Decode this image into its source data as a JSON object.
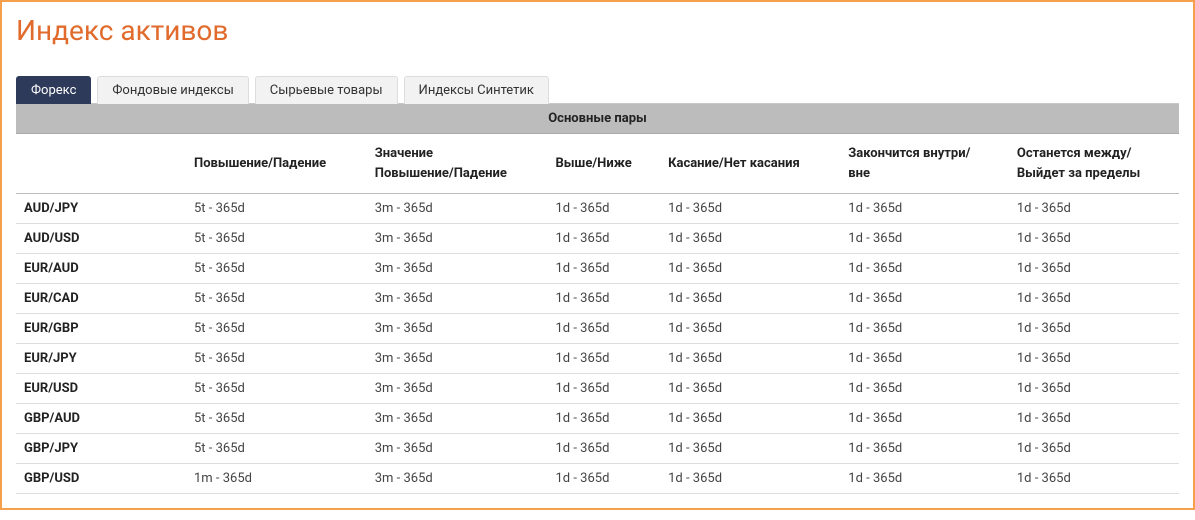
{
  "title": "Индекс активов",
  "tabs": [
    {
      "label": "Форекс",
      "active": true
    },
    {
      "label": "Фондовые индексы",
      "active": false
    },
    {
      "label": "Сырьевые товары",
      "active": false
    },
    {
      "label": "Индексы Синтетик",
      "active": false
    }
  ],
  "section_header": "Основные пары",
  "columns": [
    "",
    "Повышение/Падение",
    "Значение\nПовышение/Падение",
    "Выше/Ниже",
    "Касание/Нет касания",
    "Закончится внутри/\nвне",
    "Останется между/\nВыйдет за пределы"
  ],
  "rows": [
    {
      "pair": "AUD/JPY",
      "cells": [
        "5t - 365d",
        "3m - 365d",
        "1d - 365d",
        "1d - 365d",
        "1d - 365d",
        "1d - 365d"
      ]
    },
    {
      "pair": "AUD/USD",
      "cells": [
        "5t - 365d",
        "3m - 365d",
        "1d - 365d",
        "1d - 365d",
        "1d - 365d",
        "1d - 365d"
      ]
    },
    {
      "pair": "EUR/AUD",
      "cells": [
        "5t - 365d",
        "3m - 365d",
        "1d - 365d",
        "1d - 365d",
        "1d - 365d",
        "1d - 365d"
      ]
    },
    {
      "pair": "EUR/CAD",
      "cells": [
        "5t - 365d",
        "3m - 365d",
        "1d - 365d",
        "1d - 365d",
        "1d - 365d",
        "1d - 365d"
      ]
    },
    {
      "pair": "EUR/GBP",
      "cells": [
        "5t - 365d",
        "3m - 365d",
        "1d - 365d",
        "1d - 365d",
        "1d - 365d",
        "1d - 365d"
      ]
    },
    {
      "pair": "EUR/JPY",
      "cells": [
        "5t - 365d",
        "3m - 365d",
        "1d - 365d",
        "1d - 365d",
        "1d - 365d",
        "1d - 365d"
      ]
    },
    {
      "pair": "EUR/USD",
      "cells": [
        "5t - 365d",
        "3m - 365d",
        "1d - 365d",
        "1d - 365d",
        "1d - 365d",
        "1d - 365d"
      ]
    },
    {
      "pair": "GBP/AUD",
      "cells": [
        "5t - 365d",
        "3m - 365d",
        "1d - 365d",
        "1d - 365d",
        "1d - 365d",
        "1d - 365d"
      ]
    },
    {
      "pair": "GBP/JPY",
      "cells": [
        "5t - 365d",
        "3m - 365d",
        "1d - 365d",
        "1d - 365d",
        "1d - 365d",
        "1d - 365d"
      ]
    },
    {
      "pair": "GBP/USD",
      "cells": [
        "1m - 365d",
        "3m - 365d",
        "1d - 365d",
        "1d - 365d",
        "1d - 365d",
        "1d - 365d"
      ]
    }
  ]
}
